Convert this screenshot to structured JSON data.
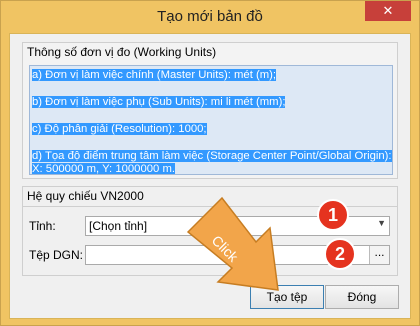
{
  "window": {
    "title": "Tạo mới bản đồ",
    "close_glyph": "✕"
  },
  "working_units": {
    "group_title": "Thông số đơn vị đo (Working Units)",
    "lines": [
      "a) Đơn vị làm việc chính (Master Units): mét (m);",
      "b) Đơn vị làm việc phụ (Sub Units): mi li mét (mm);",
      "c) Độ phân giải (Resolution): 1000;",
      "d) Tọa độ điểm trung tâm làm việc (Storage Center Point/Global Origin):",
      "X: 500000 m, Y: 1000000 m."
    ]
  },
  "reference": {
    "group_title": "Hệ quy chiếu VN2000",
    "province_label": "Tỉnh:",
    "province_value": "[Chọn tỉnh]",
    "dgn_label": "Tệp DGN:",
    "dgn_value": "",
    "browse_label": "..."
  },
  "buttons": {
    "create": "Tạo tệp",
    "close": "Đóng"
  },
  "annotations": {
    "badge1": "1",
    "badge2": "2",
    "arrow_text": "Click",
    "badge_color": "#e5331f",
    "arrow_color": "#f2a54a"
  }
}
